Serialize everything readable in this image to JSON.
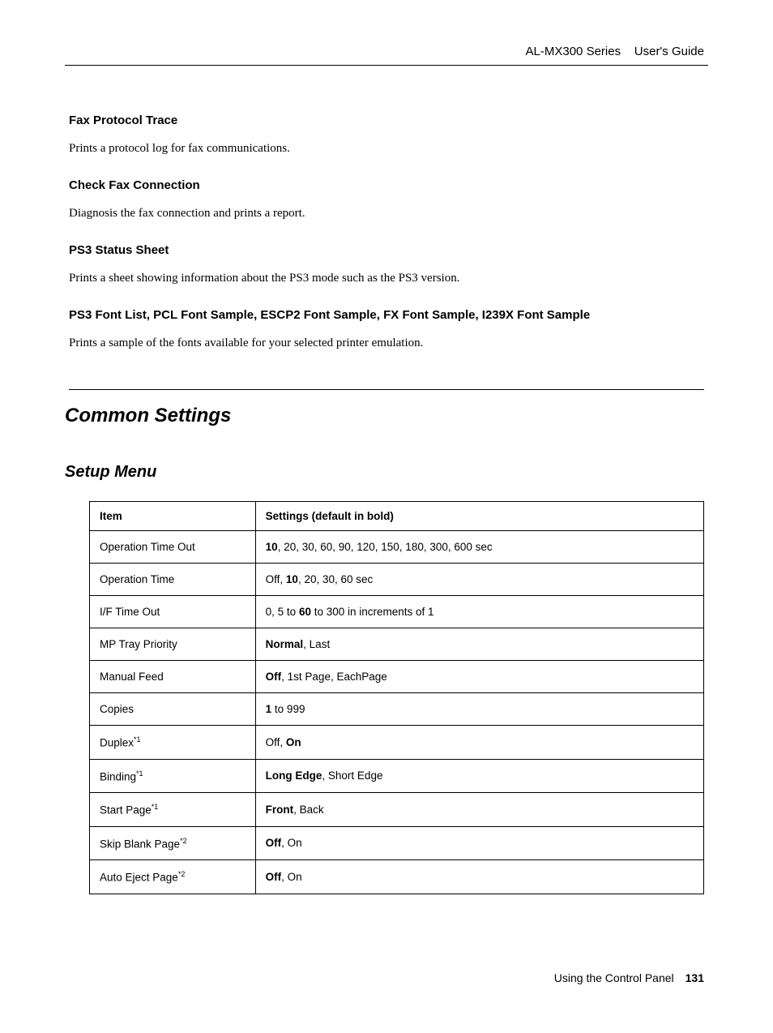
{
  "header": {
    "product": "AL-MX300 Series",
    "doc": "User's Guide"
  },
  "sections": [
    {
      "heading": "Fax Protocol Trace",
      "text": "Prints a protocol log for fax communications."
    },
    {
      "heading": "Check Fax Connection",
      "text": "Diagnosis the fax connection and prints a report."
    },
    {
      "heading": "PS3 Status Sheet",
      "text": "Prints a sheet showing information about the PS3 mode such as the PS3 version."
    },
    {
      "heading": "PS3 Font List,  PCL Font Sample,  ESCP2 Font Sample,  FX Font Sample,  I239X Font Sample",
      "text": "Prints a sample of the fonts available for your selected printer emulation."
    }
  ],
  "main_heading": "Common Settings",
  "sub_heading": "Setup Menu",
  "table": {
    "headers": {
      "item": "Item",
      "settings": "Settings (default in bold)"
    },
    "rows": [
      {
        "item": "Operation Time Out",
        "settings_html": "<span class='bold'>10</span>, 20, 30, 60, 90, 120, 150, 180, 300, 600 sec"
      },
      {
        "item": "Operation Time",
        "settings_html": "Off, <span class='bold'>10</span>, 20, 30, 60 sec"
      },
      {
        "item": "I/F Time Out",
        "settings_html": "0, 5 to <span class='bold'>60</span> to 300 in increments of 1"
      },
      {
        "item": "MP Tray Priority",
        "settings_html": "<span class='bold'>Normal</span>, Last"
      },
      {
        "item": "Manual Feed",
        "settings_html": "<span class='bold'>Off</span>, 1st Page, EachPage"
      },
      {
        "item": "Copies",
        "settings_html": "<span class='bold'>1</span> to 999"
      },
      {
        "item_html": "Duplex<sup>*1</sup>",
        "settings_html": "Off, <span class='bold'>On</span>"
      },
      {
        "item_html": "Binding<sup>*1</sup>",
        "settings_html": "<span class='bold'>Long Edge</span>, Short Edge"
      },
      {
        "item_html": "Start Page<sup>*1</sup>",
        "settings_html": "<span class='bold'>Front</span>, Back"
      },
      {
        "item_html": "Skip Blank Page<sup>*2</sup>",
        "settings_html": "<span class='bold'>Off</span>, On"
      },
      {
        "item_html": "Auto Eject Page<sup>*2</sup>",
        "settings_html": "<span class='bold'>Off</span>, On"
      }
    ]
  },
  "footer": {
    "text": "Using the Control Panel",
    "page": "131"
  }
}
